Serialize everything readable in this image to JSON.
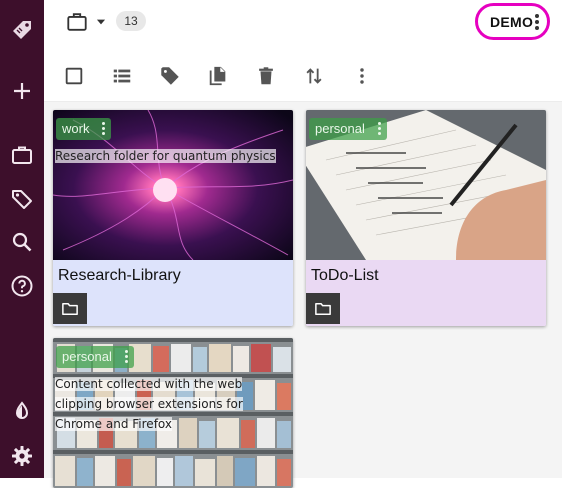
{
  "sidebar": {
    "items": [
      {
        "name": "app-logo-icon"
      },
      {
        "name": "plus-icon"
      },
      {
        "name": "briefcase-icon"
      },
      {
        "name": "tag-icon"
      },
      {
        "name": "search-icon"
      },
      {
        "name": "help-icon"
      },
      {
        "name": "theme-icon"
      },
      {
        "name": "settings-icon"
      }
    ],
    "bg_color": "#3d0f2b"
  },
  "header": {
    "location_icon": "briefcase-icon",
    "item_count": "13",
    "user_label": "DEMO",
    "user_highlight_color": "#e600c0"
  },
  "toolbar": {
    "tools": [
      "select-all-checkbox",
      "list-view-icon",
      "tag-icon",
      "copy-icon",
      "delete-icon",
      "sort-icon",
      "more-vert-icon"
    ]
  },
  "cards": [
    {
      "title": "Research-Library",
      "tag": "work",
      "description": "Research folder for quantum physics",
      "footer_color": "#dde3fb"
    },
    {
      "title": "ToDo-List",
      "tag": "personal",
      "description": "",
      "footer_color": "#ead9f3"
    },
    {
      "title": "",
      "tag": "personal",
      "description": "Content collected with the web clipping browser extensions for Chrome and Firefox",
      "footer_color": "#ffffff"
    }
  ]
}
